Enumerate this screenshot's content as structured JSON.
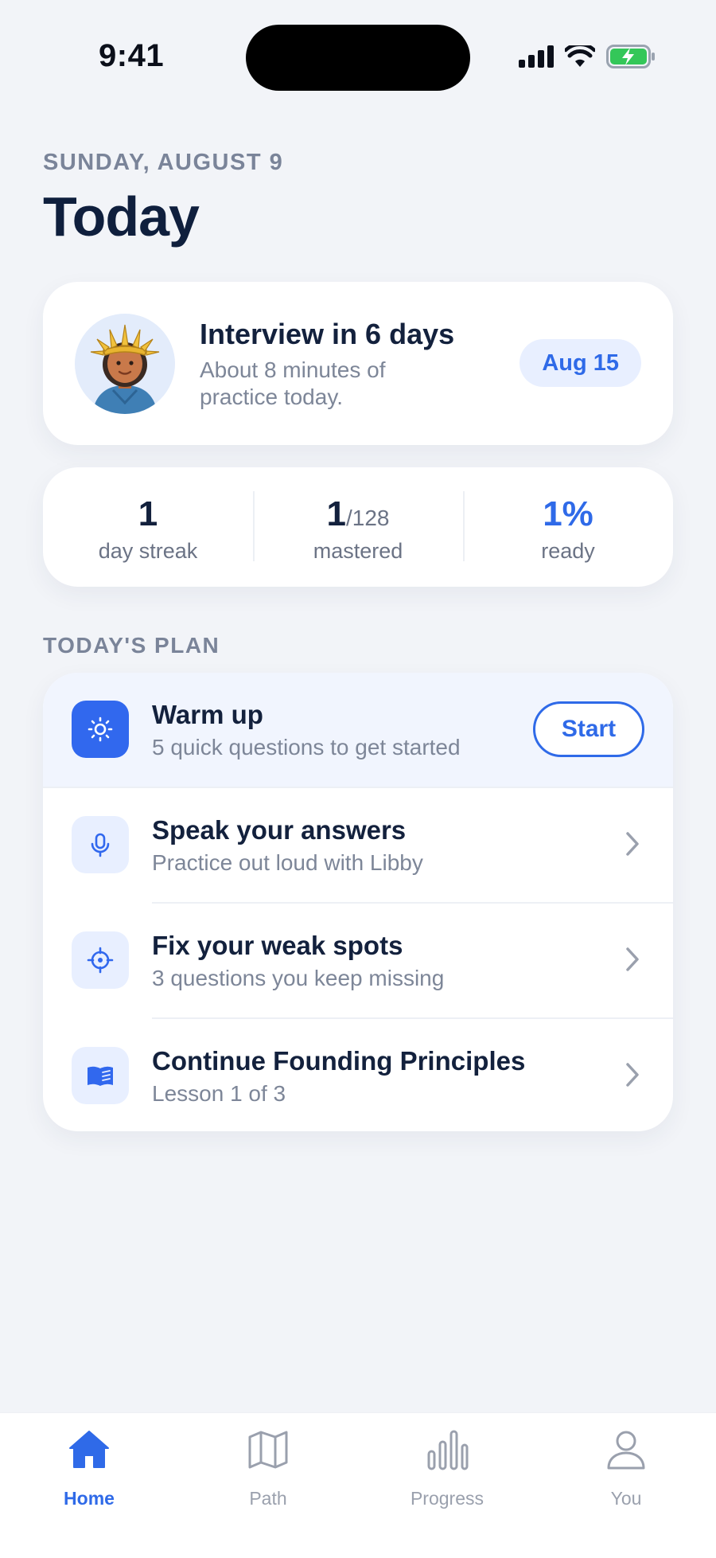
{
  "status_bar": {
    "time": "9:41"
  },
  "header": {
    "date": "SUNDAY, AUGUST 9",
    "title": "Today"
  },
  "interview": {
    "title": "Interview in 6 days",
    "subtitle": "About 8 minutes of practice today.",
    "date_pill": "Aug 15",
    "avatar_icon": "statue-of-liberty-avatar"
  },
  "stats": [
    {
      "value": "1",
      "value_suffix": "",
      "label": "day streak"
    },
    {
      "value": "1",
      "value_suffix": "/128",
      "label": "mastered"
    },
    {
      "value": "1%",
      "value_suffix": "",
      "label": "ready"
    }
  ],
  "plan": {
    "section_label": "TODAY'S PLAN",
    "items": [
      {
        "title": "Warm up",
        "subtitle": "5 quick questions to get started",
        "icon": "sun-icon",
        "action": "Start"
      },
      {
        "title": "Speak your answers",
        "subtitle": "Practice out loud with Libby",
        "icon": "microphone-icon"
      },
      {
        "title": "Fix your weak spots",
        "subtitle": "3 questions you keep missing",
        "icon": "target-icon"
      },
      {
        "title": "Continue Founding Principles",
        "subtitle": "Lesson 1 of 3",
        "icon": "book-icon"
      }
    ]
  },
  "tabs": [
    {
      "label": "Home",
      "icon": "home-icon",
      "active": true
    },
    {
      "label": "Path",
      "icon": "map-icon",
      "active": false
    },
    {
      "label": "Progress",
      "icon": "bar-chart-icon",
      "active": false
    },
    {
      "label": "You",
      "icon": "person-icon",
      "active": false
    }
  ],
  "colors": {
    "accent": "#2f6ae8",
    "background": "#f2f4f8",
    "text": "#13213d",
    "muted": "#7d8698"
  }
}
